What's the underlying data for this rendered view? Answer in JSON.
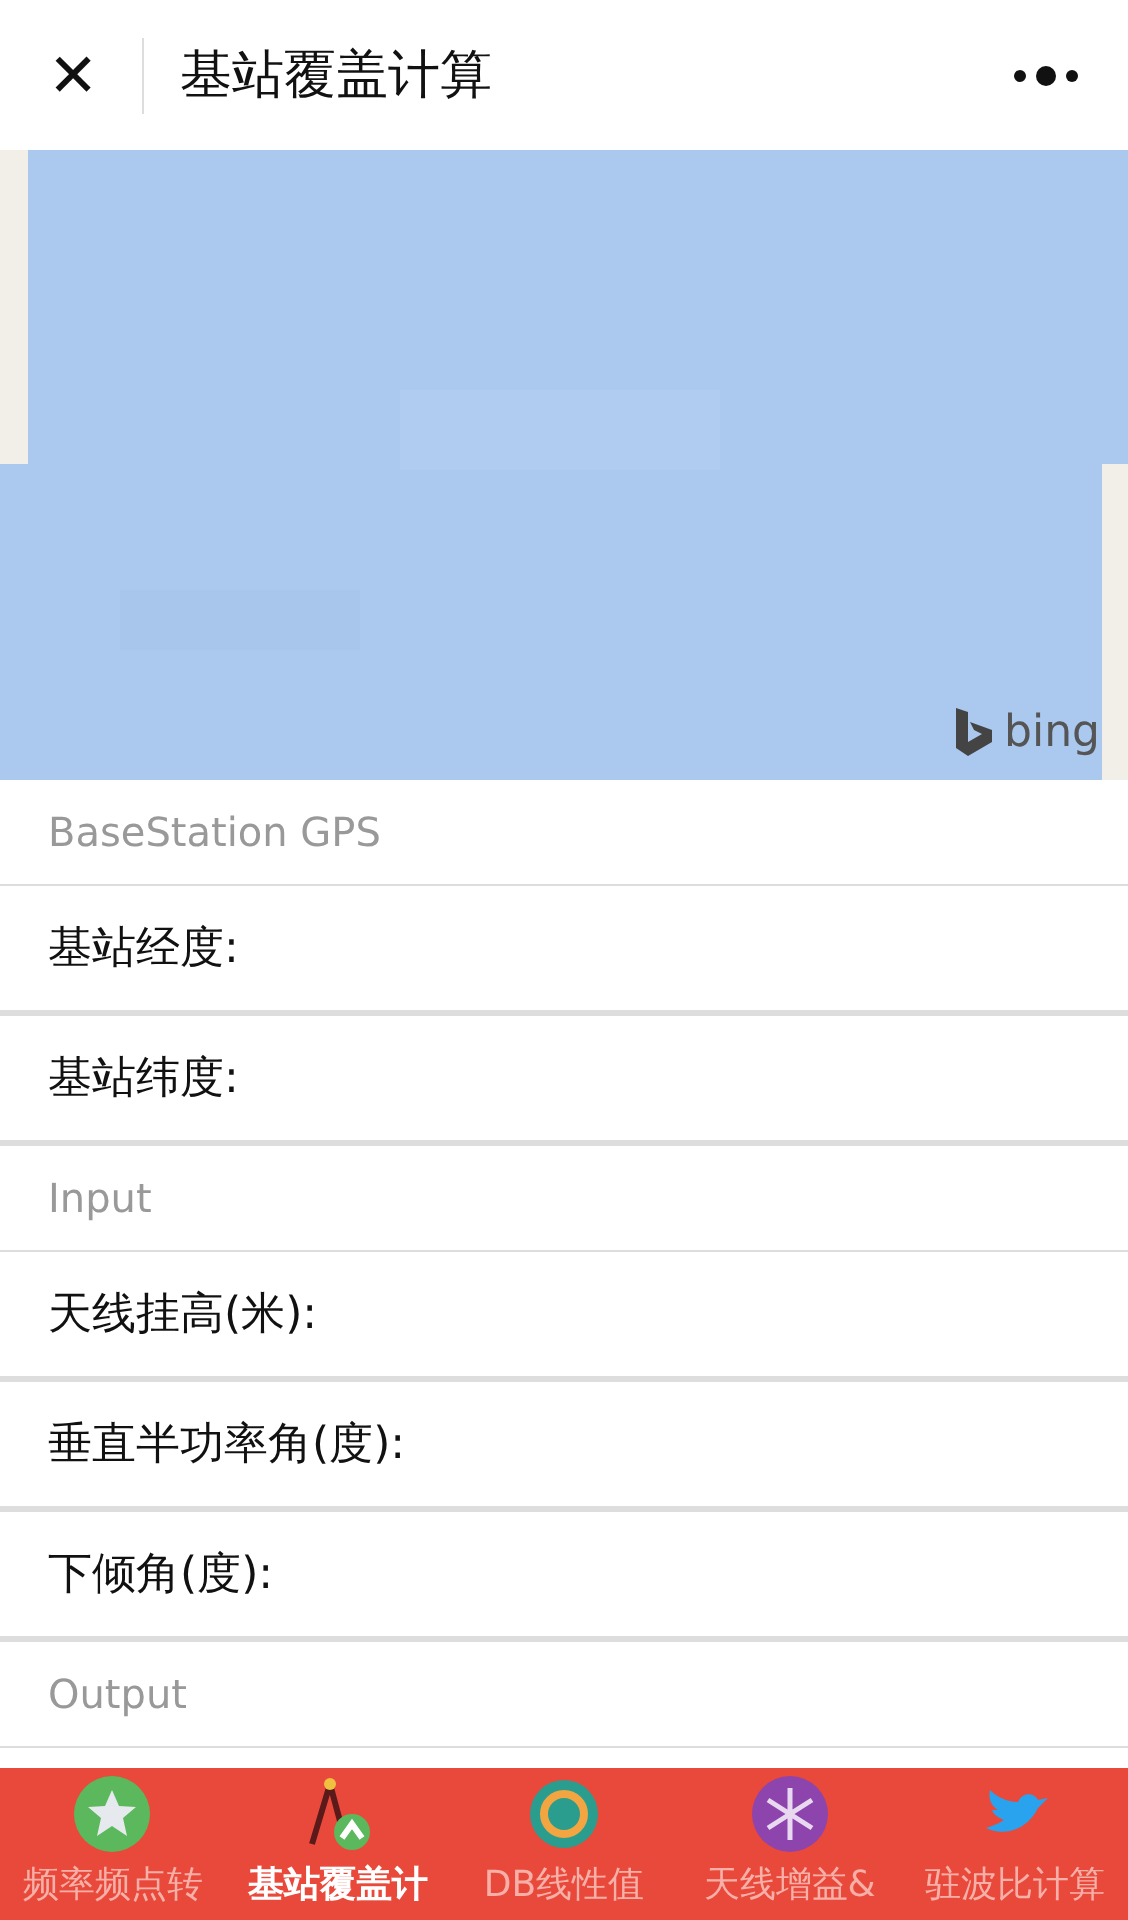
{
  "header": {
    "close": "✕",
    "title": "基站覆盖计算"
  },
  "map": {
    "kind": "picture",
    "attribution": "bing"
  },
  "sections": [
    {
      "title": "BaseStation GPS",
      "fields": [
        {
          "label": "基站经度:"
        },
        {
          "label": "基站纬度:"
        }
      ]
    },
    {
      "title": "Input",
      "fields": [
        {
          "label": "天线挂高(米):"
        },
        {
          "label": "垂直半功率角(度):"
        },
        {
          "label": "下倾角(度):"
        }
      ]
    },
    {
      "title": "Output"
    }
  ],
  "tabs": [
    {
      "label": "频率频点转",
      "selected": false
    },
    {
      "label": "基站覆盖计",
      "selected": true
    },
    {
      "label": "DB线性值",
      "selected": false
    },
    {
      "label": "天线增益&",
      "selected": false
    },
    {
      "label": "驻波比计算",
      "selected": false
    }
  ]
}
